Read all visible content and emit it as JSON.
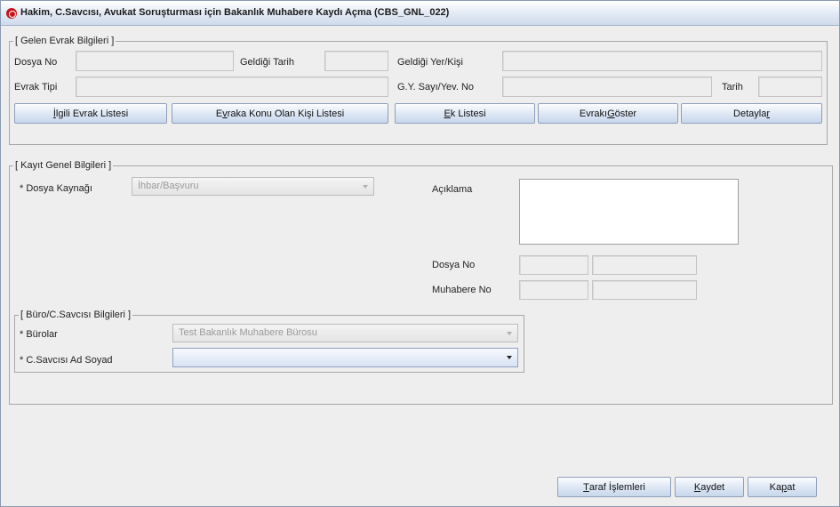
{
  "window": {
    "title": "Hakim, C.Savcısı, Avukat Soruşturması için Bakanlık Muhabere Kaydı Açma (CBS_GNL_022)"
  },
  "incoming": {
    "title": "[ Gelen Evrak Bilgileri ]",
    "dosya_no_label": "Dosya No",
    "geldigi_tarih_label": "Geldiği Tarih",
    "geldigi_yer_label": "Geldiği Yer/Kişi",
    "evrak_tipi_label": "Evrak Tipi",
    "gy_sayi_label": "G.Y. Sayı/Yev. No",
    "tarih_label": "Tarih",
    "buttons": {
      "ilgili_evrak": {
        "first": "İ",
        "rest": "lgili Evrak Listesi"
      },
      "kisi_listesi": {
        "pre": "E",
        "mn": "v",
        "rest": "raka Konu Olan Kişi Listesi"
      },
      "ek_listesi": {
        "first": "E",
        "rest": "k Listesi"
      },
      "evraki_goster": {
        "pre": "Evrakı ",
        "mn": "G",
        "rest": "öster"
      },
      "detaylar": {
        "pre": "Detayla",
        "mn": "r",
        "rest": ""
      }
    }
  },
  "general": {
    "title": "[ Kayıt Genel Bilgileri ]",
    "dosya_kaynagi_label": "* Dosya Kaynağı",
    "dosya_kaynagi_value": "İhbar/Başvuru",
    "aciklama_label": "Açıklama",
    "dosya_no_label": "Dosya No",
    "muhabere_no_label": "Muhabere No"
  },
  "bureau": {
    "title": "[ Büro/C.Savcısı Bilgileri ]",
    "burolar_label": "* Bürolar",
    "burolar_value": "Test Bakanlık Muhabere Bürosu",
    "savci_label": "* C.Savcısı Ad Soyad",
    "savci_value": ""
  },
  "footer": {
    "taraf": {
      "first": "T",
      "rest": "araf İşlemleri"
    },
    "kaydet": {
      "first": "K",
      "rest": "aydet"
    },
    "kapat": {
      "pre": "Ka",
      "mn": "p",
      "rest": "at"
    }
  }
}
